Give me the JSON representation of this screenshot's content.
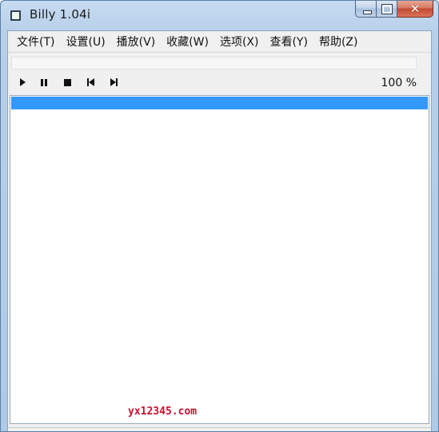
{
  "window": {
    "title": "Billy 1.04i",
    "controls": {
      "close_symbol": "✕"
    }
  },
  "menubar": {
    "items": [
      {
        "label": "文件(T)"
      },
      {
        "label": "设置(U)"
      },
      {
        "label": "播放(V)"
      },
      {
        "label": "收藏(W)"
      },
      {
        "label": "选项(X)"
      },
      {
        "label": "查看(Y)"
      },
      {
        "label": "帮助(Z)"
      }
    ]
  },
  "transport": {
    "buttons": [
      "play-icon",
      "pause-icon",
      "stop-icon",
      "previous-icon",
      "next-icon"
    ],
    "volume": "100 %"
  },
  "playlist": {
    "selection_color": "#3399ff"
  },
  "watermark": "yx12345.com"
}
